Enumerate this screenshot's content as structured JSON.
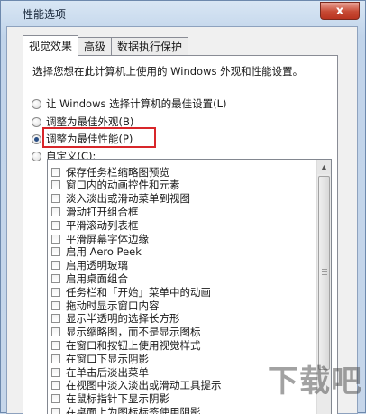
{
  "window": {
    "title": "性能选项",
    "close_glyph": "x"
  },
  "tabs": [
    {
      "label": "视觉效果",
      "active": true
    },
    {
      "label": "高级",
      "active": false
    },
    {
      "label": "数据执行保护",
      "active": false
    }
  ],
  "description": "选择您想在此计算机上使用的 Windows 外观和性能设置。",
  "radio_options": [
    {
      "label": "让 Windows 选择计算机的最佳设置(L)",
      "checked": false
    },
    {
      "label": "调整为最佳外观(B)",
      "checked": false
    },
    {
      "label": "调整为最佳性能(P)",
      "checked": true
    },
    {
      "label": "自定义(C):",
      "checked": false
    }
  ],
  "effects": [
    "保存任务栏缩略图预览",
    "窗口内的动画控件和元素",
    "淡入淡出或滑动菜单到视图",
    "滑动打开组合框",
    "平滑滚动列表框",
    "平滑屏幕字体边缘",
    "启用 Aero Peek",
    "启用透明玻璃",
    "启用桌面组合",
    "任务栏和「开始」菜单中的动画",
    "拖动时显示窗口内容",
    "显示半透明的选择长方形",
    "显示缩略图，而不是显示图标",
    "在窗口和按钮上使用视觉样式",
    "在窗口下显示阴影",
    "在单击后淡出菜单",
    "在视图中淡入淡出或滑动工具提示",
    "在鼠标指针下显示阴影",
    "在桌面上为图标标签使用阴影"
  ],
  "watermark": "下载吧",
  "colors": {
    "highlight": "#d8262a",
    "radio_dot": "#2a4f86"
  }
}
